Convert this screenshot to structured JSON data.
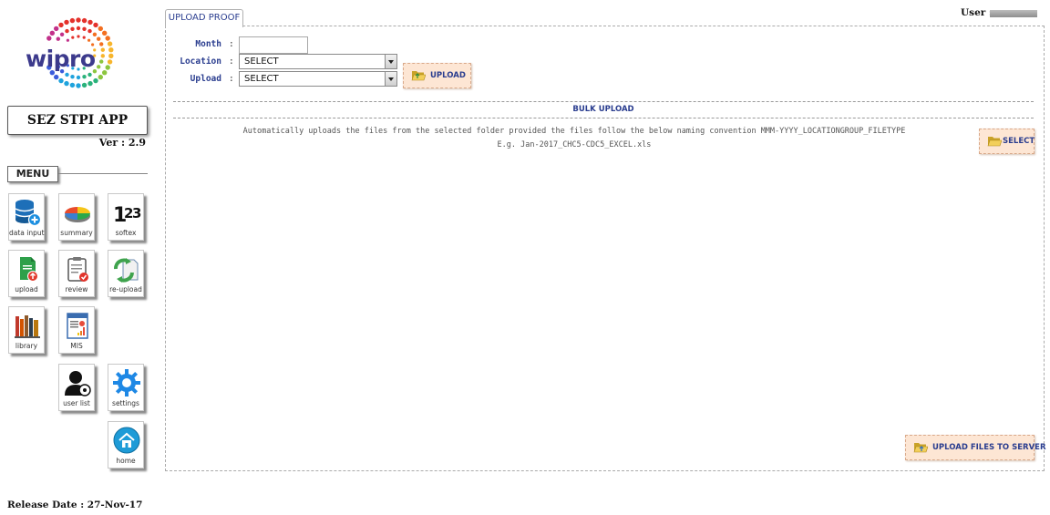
{
  "sidebar": {
    "logo_text": "wipro",
    "app_title": "SEZ STPI APP",
    "version_label": "Ver :",
    "version_value": "2.9",
    "menu_label": "MENU",
    "tiles": [
      {
        "label": "data input",
        "icon": "database-add-icon"
      },
      {
        "label": "summary",
        "icon": "pie-chart-icon"
      },
      {
        "label": "softex",
        "icon": "numbers-123-icon"
      },
      {
        "label": "upload",
        "icon": "document-upload-icon"
      },
      {
        "label": "review",
        "icon": "clipboard-check-icon"
      },
      {
        "label": "re-upload",
        "icon": "refresh-document-icon"
      },
      {
        "label": "library",
        "icon": "books-icon"
      },
      {
        "label": "MIS",
        "icon": "report-chart-icon"
      },
      {
        "label": "user list",
        "icon": "user-settings-icon"
      },
      {
        "label": "settings",
        "icon": "gear-icon"
      },
      {
        "label": "home",
        "icon": "home-icon"
      }
    ],
    "release_label": "Release Date :",
    "release_value": "27-Nov-17"
  },
  "header": {
    "user_label": "User :"
  },
  "main": {
    "tab_label": "UPLOAD PROOF",
    "form": {
      "month_label": "Month",
      "month_value": "",
      "location_label": "Location",
      "location_value": "SELECT",
      "upload_label": "Upload",
      "upload_value": "SELECT",
      "colon": ":"
    },
    "upload_button": "UPLOAD",
    "bulk": {
      "title": "BULK UPLOAD",
      "description_1": "Automatically uploads the files from the selected folder provided the files follow the below naming convention MMM-YYYY_LOCATIONGROUP_FILETYPE",
      "description_2": "E.g. Jan-2017_CHC5-CDC5_EXCEL.xls",
      "select_button": "SELECT",
      "upload_server_button": "UPLOAD FILES TO SERVER"
    }
  },
  "colors": {
    "accent_blue": "#2a3d8f",
    "button_bg": "#fde6d4"
  }
}
